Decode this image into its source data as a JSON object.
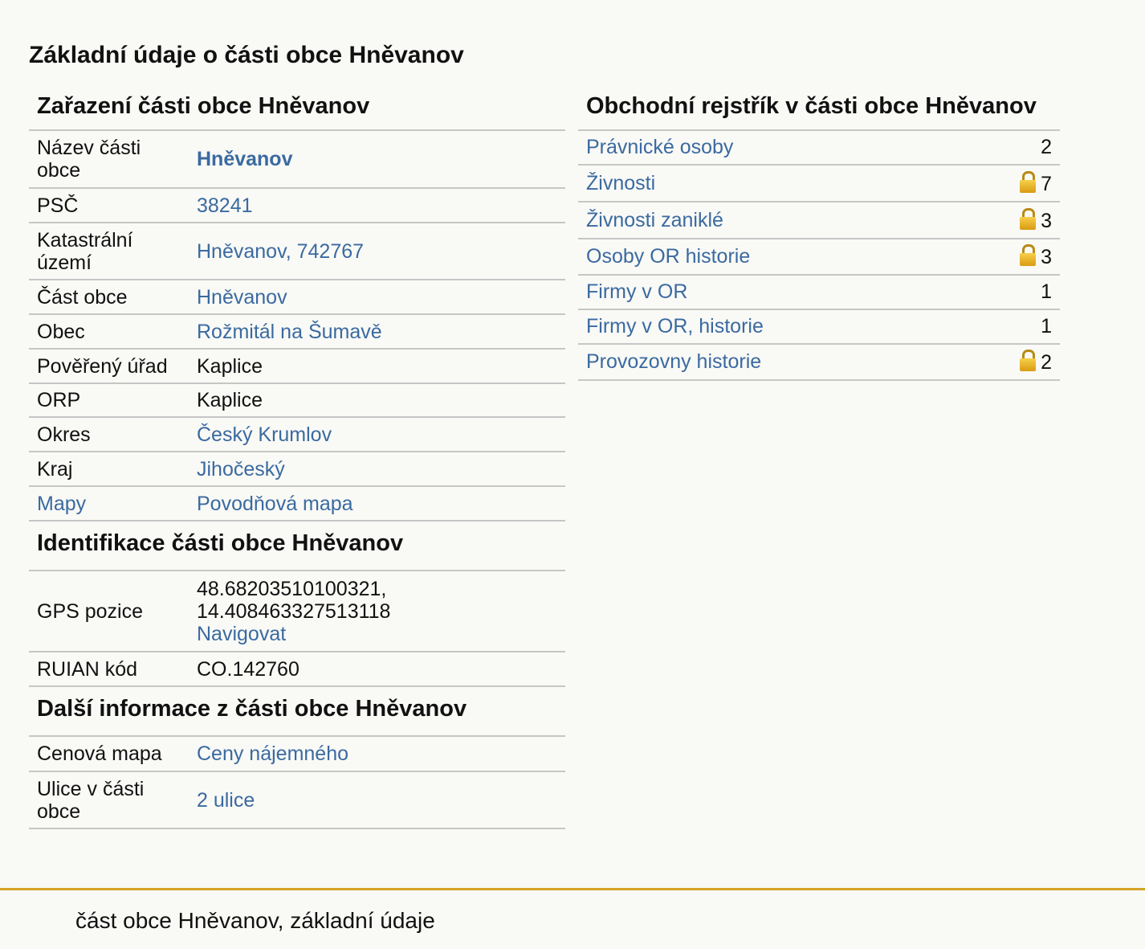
{
  "page_title": "Základní údaje o části obce Hněvanov",
  "zarazeni": {
    "heading": "Zařazení části obce Hněvanov",
    "rows": [
      {
        "label": "Název části obce",
        "value": "Hněvanov"
      },
      {
        "label": "PSČ",
        "value": "38241"
      },
      {
        "label": "Katastrální území",
        "value": "Hněvanov, 742767"
      },
      {
        "label": "Část obce",
        "value": "Hněvanov"
      },
      {
        "label": "Obec",
        "value": "Rožmitál na Šumavě"
      },
      {
        "label": "Pověřený úřad",
        "value": "Kaplice"
      },
      {
        "label": "ORP",
        "value": "Kaplice"
      },
      {
        "label": "Okres",
        "value": "Český Krumlov"
      },
      {
        "label": "Kraj",
        "value": "Jihočeský"
      },
      {
        "label": "Mapy",
        "value": "Povodňová mapa"
      }
    ]
  },
  "identifikace": {
    "heading": "Identifikace části obce Hněvanov",
    "gps_label": "GPS pozice",
    "gps_lat": "48.68203510100321,",
    "gps_lon": "14.408463327513118",
    "gps_link": "Navigovat",
    "ruian_label": "RUIAN kód",
    "ruian_value": "CO.142760"
  },
  "dalsi": {
    "heading": "Další informace z části obce Hněvanov",
    "rows": [
      {
        "label": "Cenová mapa",
        "value": "Ceny nájemného"
      },
      {
        "label": "Ulice v části obce",
        "value": "2 ulice"
      }
    ]
  },
  "obchodni_rejstrik": {
    "heading": "Obchodní rejstřík v části obce Hněvanov",
    "rows": [
      {
        "label": "Právnické osoby",
        "count": "2",
        "locked": false
      },
      {
        "label": "Živnosti",
        "count": "7",
        "locked": true
      },
      {
        "label": "Živnosti zaniklé",
        "count": "3",
        "locked": true
      },
      {
        "label": "Osoby OR historie",
        "count": "3",
        "locked": true
      },
      {
        "label": "Firmy v OR",
        "count": "1",
        "locked": false
      },
      {
        "label": "Firmy v OR, historie",
        "count": "1",
        "locked": false
      },
      {
        "label": "Provozovny historie",
        "count": "2",
        "locked": true
      }
    ]
  },
  "footer": {
    "text": "část obce Hněvanov, základní údaje"
  },
  "colors": {
    "link": "#3a6aa0",
    "footer_border": "#d5a326",
    "lock": "#e8b42a",
    "background": "#f9f9f6"
  }
}
